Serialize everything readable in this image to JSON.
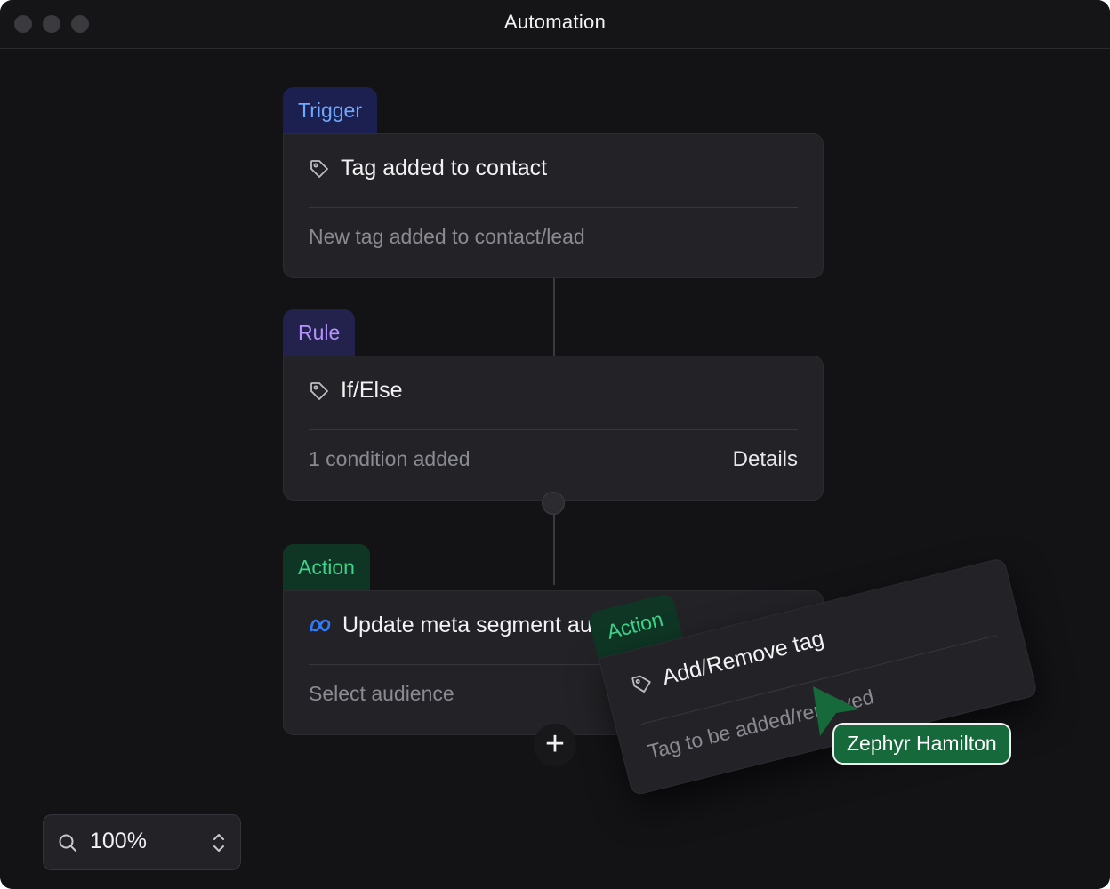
{
  "window": {
    "title": "Automation"
  },
  "trigger": {
    "tab": "Trigger",
    "title": "Tag added to contact",
    "description": "New tag added to contact/lead"
  },
  "rule": {
    "tab": "Rule",
    "title": "If/Else",
    "description": "1 condition added",
    "details": "Details"
  },
  "action": {
    "tab": "Action",
    "title": "Update meta segment audience",
    "description": "Select audience"
  },
  "dragging": {
    "tab": "Action",
    "title": "Add/Remove tag",
    "description": "Tag to be added/removed"
  },
  "cursor": {
    "name": "Zephyr Hamilton"
  },
  "zoom": {
    "value": "100%"
  },
  "icons": {
    "tag": "tag-icon",
    "meta": "meta-logo-icon",
    "plus": "plus-icon",
    "zoom": "search-icon",
    "stepper": "chevron-up-down-icon"
  },
  "colors": {
    "trigger": "#6ea8ff",
    "rule": "#b692ff",
    "action": "#3ed38a",
    "cursor": "#16693a"
  }
}
